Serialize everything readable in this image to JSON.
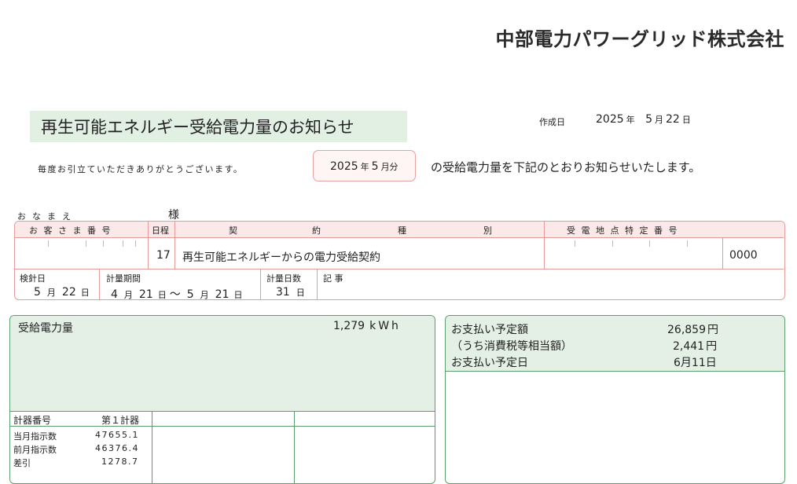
{
  "header": {
    "company": "中部電力パワーグリッド株式会社",
    "title": "再生可能エネルギー受給電力量のお知らせ",
    "created_label": "作成日",
    "created_year": "2025",
    "created_year_unit": "年",
    "created_month": "5",
    "created_month_unit": "月",
    "created_day": "22",
    "created_day_unit": "日"
  },
  "notice": {
    "greeting": "毎度お引立ていただきありがとうございます。",
    "month_year": "2025",
    "month_year_unit": "年",
    "month": "5",
    "month_unit": "月分",
    "after": "の受給電力量を下記のとおりお知らせいたします。"
  },
  "customer": {
    "name_label": "おなまえ",
    "honorific": "様"
  },
  "contract_table": {
    "headers": {
      "customer_no": "お 客 さ ま 番 号",
      "schedule": "日程",
      "contract_type": [
        "契",
        "約",
        "種",
        "別"
      ],
      "point_id": "受 電 地 点 特 定 番 号"
    },
    "schedule_value": "17",
    "contract_value": "再生可能エネルギーからの電力受給契約",
    "point_id_tail": "0000",
    "reading_date_label": "検針日",
    "reading_month": "5",
    "reading_day": "22",
    "period_label": "計量期間",
    "period_from_month": "4",
    "period_from_day": "21",
    "period_to_month": "5",
    "period_to_day": "21",
    "days_label": "計量日数",
    "days_value": "31",
    "notes_label": "記 事",
    "unit_month": "月",
    "unit_day": "日",
    "tilde": "～"
  },
  "energy_panel": {
    "label": "受給電力量",
    "value": "1,279",
    "unit": "kWh",
    "meter_no_label": "計器番号",
    "meter_name": "第１計器",
    "rows": [
      {
        "label": "当月指示数",
        "value": "47655.1"
      },
      {
        "label": "前月指示数",
        "value": "46376.4"
      },
      {
        "label": "差引",
        "value": "1278.7"
      }
    ]
  },
  "payment_panel": {
    "amount_label": "お支払い予定額",
    "amount_value": "26,859",
    "amount_unit": "円",
    "tax_label": "（うち消費税等相当額）",
    "tax_value": "2,441",
    "tax_unit": "円",
    "date_label": "お支払い予定日",
    "date_value": "6月11日"
  }
}
